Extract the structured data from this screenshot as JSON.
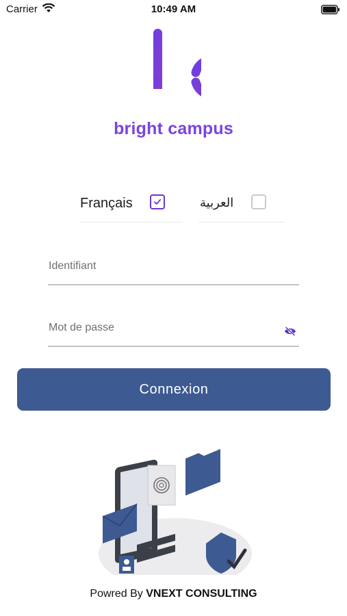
{
  "status_bar": {
    "carrier": "Carrier",
    "time": "10:49 AM"
  },
  "brand": {
    "name": "bright campus",
    "color": "#7a44e0"
  },
  "languages": [
    {
      "label": "Français",
      "checked": true
    },
    {
      "label": "العربية",
      "checked": false
    }
  ],
  "form": {
    "username_placeholder": "Identifiant",
    "password_placeholder": "Mot de passe",
    "submit_label": "Connexion",
    "button_color": "#3e5a92"
  },
  "footer": {
    "prefix": "Powred By",
    "company": "VNEXT CONSULTING"
  },
  "icons": [
    "wifi-icon",
    "battery-icon",
    "check-icon",
    "eye-slash-icon"
  ]
}
